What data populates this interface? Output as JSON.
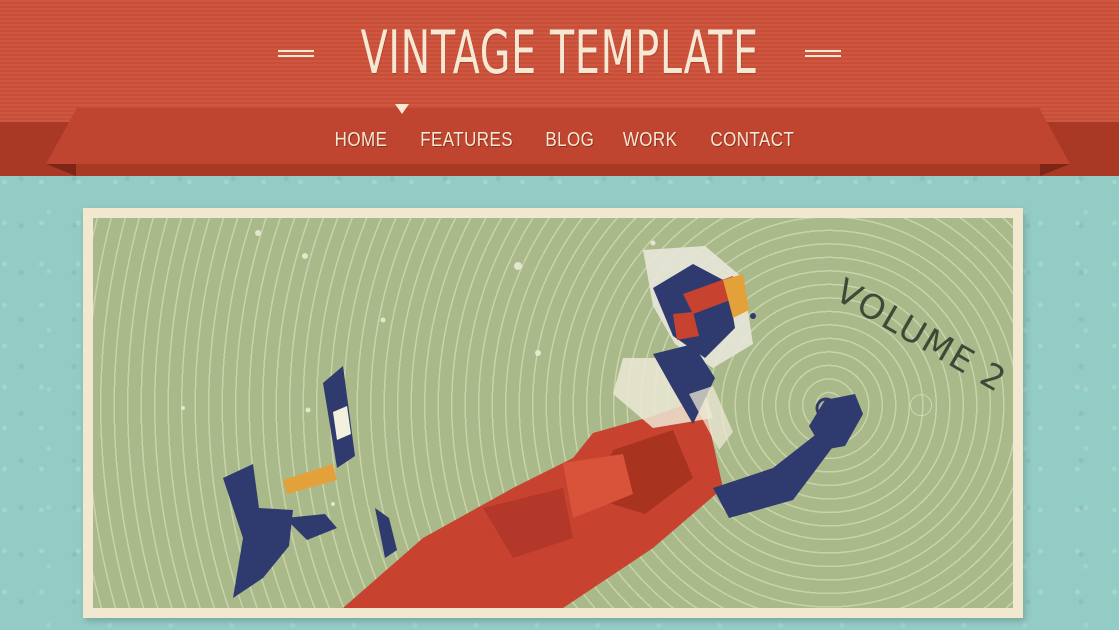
{
  "site": {
    "title": "VINTAGE TEMPLATE"
  },
  "nav": {
    "items": [
      "HOME",
      "FEATURES",
      "BLOG",
      "WORK",
      "CONTACT"
    ],
    "active": "HOME"
  },
  "hero": {
    "art_text": "VOLUME 2"
  },
  "colors": {
    "header": "#cc5039",
    "ribbon": "#bf4530",
    "background": "#93cbc5",
    "frame": "#f2e7cf",
    "text": "#f6e9d4"
  },
  "icons": {
    "nav_indicator": "triangle-down-icon"
  }
}
